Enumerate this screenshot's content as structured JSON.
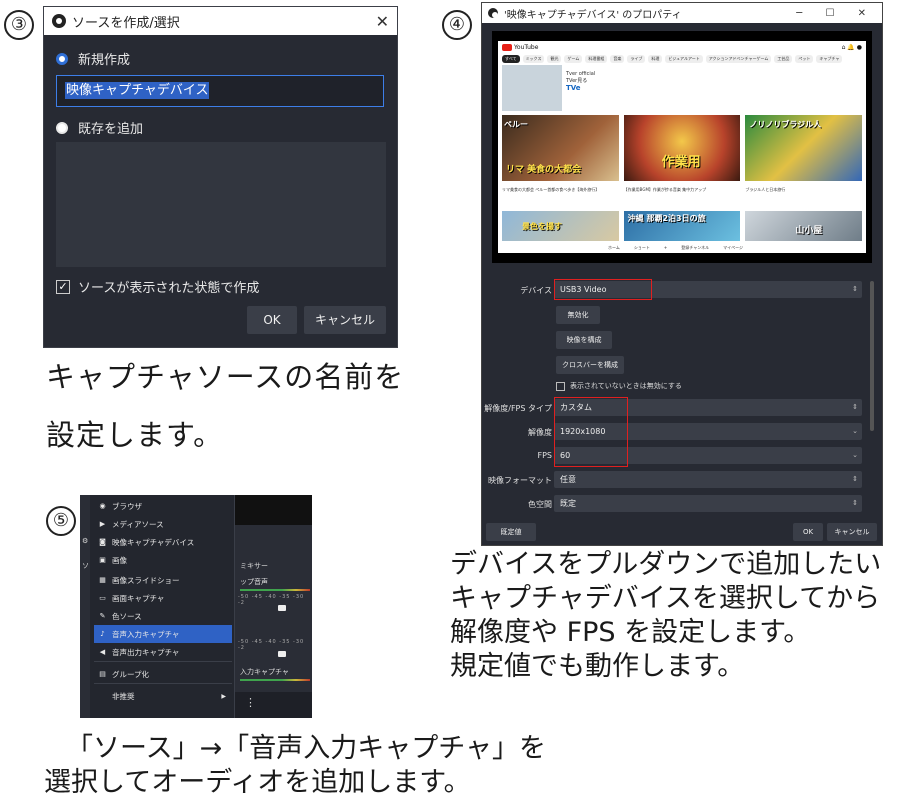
{
  "steps": {
    "s3": "③",
    "s4": "④",
    "s5": "⑤"
  },
  "dialog3": {
    "title": "ソースを作成/選択",
    "close": "✕",
    "new_label": "新規作成",
    "name_value": "映像キャプチャデバイス",
    "existing_label": "既存を追加",
    "visible_label": "ソースが表示された状態で作成",
    "ok": "OK",
    "cancel": "キャンセル"
  },
  "caption3": {
    "line1": "キャプチャソースの名前を",
    "line2": "設定します。"
  },
  "dialog4": {
    "title": "'映像キャプチャデバイス' のプロパティ",
    "window_controls": "─ ☐ ✕",
    "youtube": {
      "logo_text": "YouTube",
      "chips": [
        "すべて",
        "ミックス",
        "観光",
        "ゲーム",
        "料理番組",
        "音楽",
        "ライブ",
        "料理",
        "ビジュアルアート",
        "アクションアドベンチャーゲーム",
        "工芸品",
        "ペット",
        "キャプチャ"
      ],
      "channel": "Tver official",
      "channel_sub": "TVer見る",
      "top_badge": "TVe",
      "thumbs_row1": [
        {
          "title": "リマ 美食の大都会",
          "side": "ペルー"
        },
        {
          "title": "作業用"
        },
        {
          "title": "ノリノリブラジル人"
        }
      ],
      "metas_row1": [
        "リマ美食の大都会 ペルー首都の食べ歩き【海外旅行】",
        "【作業用BGM】作業が捗る音楽 集中力アップ",
        "ブラジル人と日本旅行"
      ],
      "thumbs_row2": [
        {
          "title": "景色を撮す"
        },
        {
          "title": "沖縄 那覇2泊3日の旅"
        },
        {
          "title": "山小屋"
        }
      ],
      "nav": [
        "ホーム",
        "ショート",
        "+",
        "登録チャンネル",
        "マイページ"
      ]
    },
    "props": {
      "device_label": "デバイス",
      "device_value": "USB3 Video",
      "btn_deactivate": "無効化",
      "btn_config_video": "映像を構成",
      "btn_crossbar": "クロスバーを構成",
      "hide_check_label": "表示されていないときは無効にする",
      "res_type_label": "解像度/FPS タイプ",
      "res_type_value": "カスタム",
      "res_label": "解像度",
      "res_value": "1920x1080",
      "fps_label": "FPS",
      "fps_value": "60",
      "format_label": "映像フォーマット",
      "format_value": "任意",
      "colorspace_label": "色空間",
      "colorspace_value": "既定"
    },
    "defaults_btn": "既定値",
    "ok": "OK",
    "cancel": "キャンセル"
  },
  "caption4": {
    "line1": "デバイスをプルダウンで追加したい",
    "line2": "キャプチャデバイスを選択してから",
    "line3": "解像度や FPS を設定します。",
    "line4": "規定値でも動作します。"
  },
  "menu5": {
    "items": [
      {
        "icon": "◉",
        "label": "ブラウザ"
      },
      {
        "icon": "▶",
        "label": "メディアソース"
      },
      {
        "icon": "◙",
        "label": "映像キャプチャデバイス"
      },
      {
        "icon": "▣",
        "label": "画像"
      },
      {
        "icon": "▦",
        "label": "画像スライドショー"
      },
      {
        "icon": "▭",
        "label": "画面キャプチャ"
      },
      {
        "icon": "✎",
        "label": "色ソース"
      },
      {
        "icon": "♪",
        "label": "音声入力キャプチャ"
      },
      {
        "icon": "◀",
        "label": "音声出力キャプチャ"
      },
      {
        "icon": "▤",
        "label": "グループ化"
      },
      {
        "icon": "",
        "label": "非推奨"
      }
    ],
    "submenu_arrow": "▶",
    "mixer_title": "ミキサー",
    "mixer_track1": "ップ音声",
    "mixer_track2": "入力キャプチャ",
    "scale": "-50 -45 -40 -35 -30 -2",
    "more": "⋮"
  },
  "caption5": {
    "line1": "「ソース」→「音声入力キャプチャ」を",
    "line2": "選択してオーディオを追加します。"
  }
}
